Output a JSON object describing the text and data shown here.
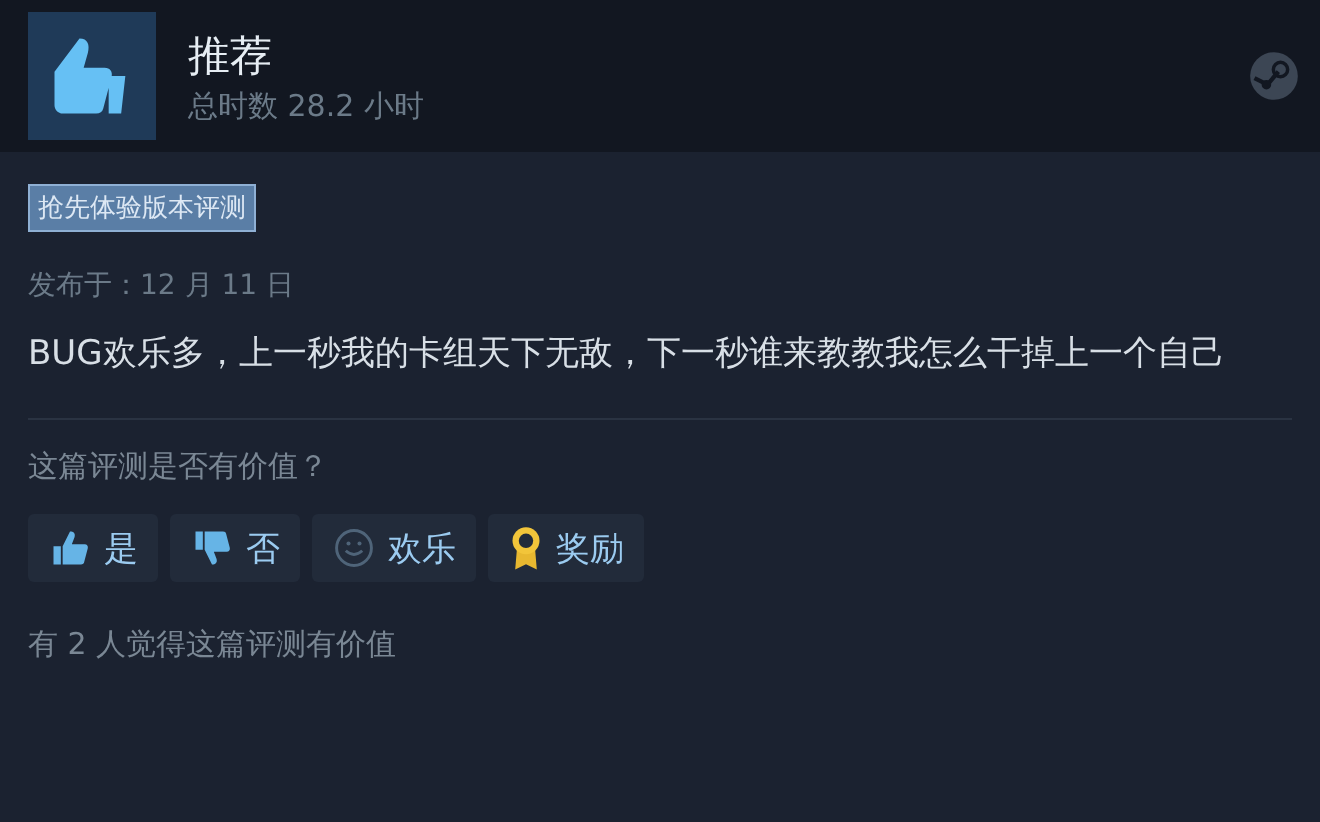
{
  "review": {
    "verdict": "推荐",
    "hours": "总时数 28.2 小时",
    "tag": "抢先体验版本评测",
    "posted": "发布于：12 月 11 日",
    "text": "BUG欢乐多，上一秒我的卡组天下无敌，下一秒谁来教教我怎么干掉上一个自己"
  },
  "feedback": {
    "question": "这篇评测是否有价值？",
    "buttons": [
      {
        "kind": "yes",
        "label": "是"
      },
      {
        "kind": "no",
        "label": "否"
      },
      {
        "kind": "funny",
        "label": "欢乐"
      },
      {
        "kind": "award",
        "label": "奖励"
      }
    ],
    "summary": "有 2 人觉得这篇评测有价值"
  }
}
